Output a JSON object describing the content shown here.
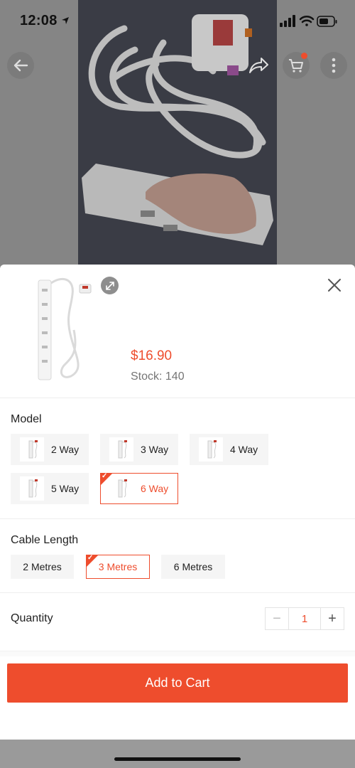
{
  "status": {
    "time": "12:08"
  },
  "nav": {
    "back_icon": "arrow-left-icon",
    "share_icon": "share-icon",
    "cart_icon": "cart-icon",
    "more_icon": "more-vertical-icon"
  },
  "product": {
    "price": "$16.90",
    "stock": "Stock: 140"
  },
  "model": {
    "title": "Model",
    "options": [
      {
        "label": "2 Way",
        "selected": false
      },
      {
        "label": "3 Way",
        "selected": false
      },
      {
        "label": "4 Way",
        "selected": false
      },
      {
        "label": "5 Way",
        "selected": false
      },
      {
        "label": "6 Way",
        "selected": true
      }
    ]
  },
  "cable": {
    "title": "Cable Length",
    "options": [
      {
        "label": "2 Metres",
        "selected": false
      },
      {
        "label": "3 Metres",
        "selected": true
      },
      {
        "label": "6 Metres",
        "selected": false
      }
    ]
  },
  "quantity": {
    "title": "Quantity",
    "value": "1",
    "minus": "−",
    "plus": "+"
  },
  "cta": {
    "add_to_cart": "Add to Cart"
  },
  "colors": {
    "accent": "#ee4d2d"
  }
}
